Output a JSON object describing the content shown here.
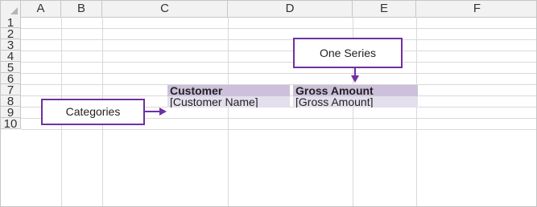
{
  "columns": [
    "A",
    "B",
    "C",
    "D",
    "E",
    "F"
  ],
  "rows": [
    "1",
    "2",
    "3",
    "4",
    "5",
    "6",
    "7",
    "8",
    "9",
    "10"
  ],
  "cells": {
    "C4": "Customer",
    "D4": "Gross Amount",
    "C5": "[Customer Name]",
    "D5": "[Gross Amount]"
  },
  "callouts": {
    "series": "One Series",
    "categories": "Categories"
  },
  "colors": {
    "header_fill": "#ccc0da",
    "value_fill": "#e4dfec",
    "callout_border": "#7030a0"
  }
}
